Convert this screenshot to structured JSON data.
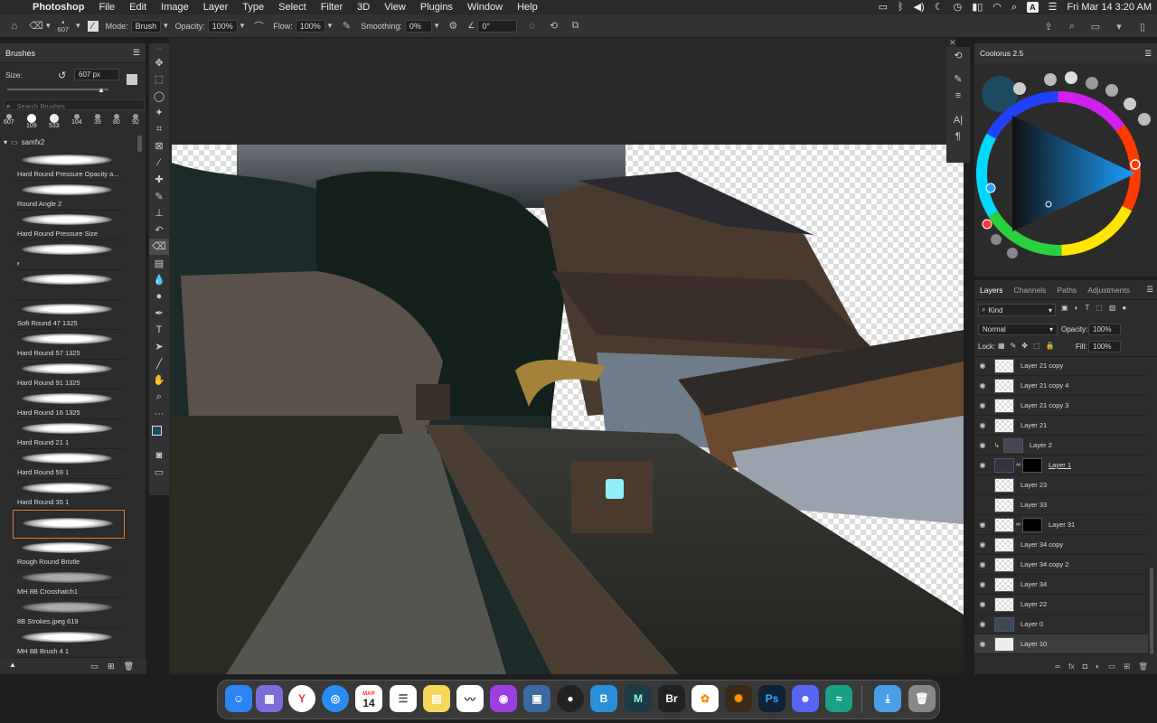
{
  "menubar": {
    "items": [
      "Photoshop",
      "File",
      "Edit",
      "Image",
      "Layer",
      "Type",
      "Select",
      "Filter",
      "3D",
      "View",
      "Plugins",
      "Window",
      "Help"
    ],
    "clock": "Fri Mar 14  3:20 AM"
  },
  "options": {
    "brush_size": "607",
    "mode_label": "Mode:",
    "mode_value": "Brush",
    "opacity_label": "Opacity:",
    "opacity_value": "100%",
    "flow_label": "Flow:",
    "flow_value": "100%",
    "smoothing_label": "Smoothing:",
    "smoothing_value": "0%",
    "angle_value": "0°"
  },
  "brushes": {
    "title": "Brushes",
    "size_label": "Size:",
    "size_value": "607 px",
    "search_placeholder": "Search Brushes",
    "presets": [
      "607",
      "109",
      "533",
      "104",
      "39",
      "80",
      "92"
    ],
    "group": "samfx2",
    "items": [
      "Hard Round Pressure Opacity a...",
      "Round Angle 2",
      "Hard Round Pressure Size",
      "ғ",
      "",
      "Soft Round 47 1325",
      "Hard Round 57 1325",
      "Hard Round 91 1325",
      "Hard Round 16 1325",
      "Hard Round 21 1",
      "Hard Round 59 1",
      "Hard Round 35 1",
      "",
      "Rough Round Bristle",
      "MH 8B Crosshatch1",
      "8B Strokes.jpeg 619",
      "MH 8B Brush 4 1"
    ]
  },
  "coolorus": {
    "title": "Coolorus 2.5",
    "foreground_color": "#1e4a60"
  },
  "layers": {
    "tabs": [
      "Layers",
      "Channels",
      "Paths",
      "Adjustments"
    ],
    "kind_label": "Kind",
    "blend_mode": "Normal",
    "opacity_label": "Opacity:",
    "opacity_value": "100%",
    "lock_label": "Lock:",
    "fill_label": "Fill:",
    "fill_value": "100%",
    "items": [
      "Layer 21 copy",
      "Layer 21 copy 4",
      "Layer 21 copy 3",
      "Layer 21",
      "Layer 2",
      "Layer 1",
      "Layer 23",
      "Layer 33",
      "Layer 31",
      "Layer 34 copy",
      "Layer 34 copy 2",
      "Layer 34",
      "Layer 22",
      "Layer 0",
      "Layer 10"
    ]
  },
  "dock": {
    "calendar_month": "MAR",
    "calendar_day": "14",
    "bridge_label": "Br",
    "photoshop_label": "Ps",
    "media_encoder_label": "M"
  }
}
